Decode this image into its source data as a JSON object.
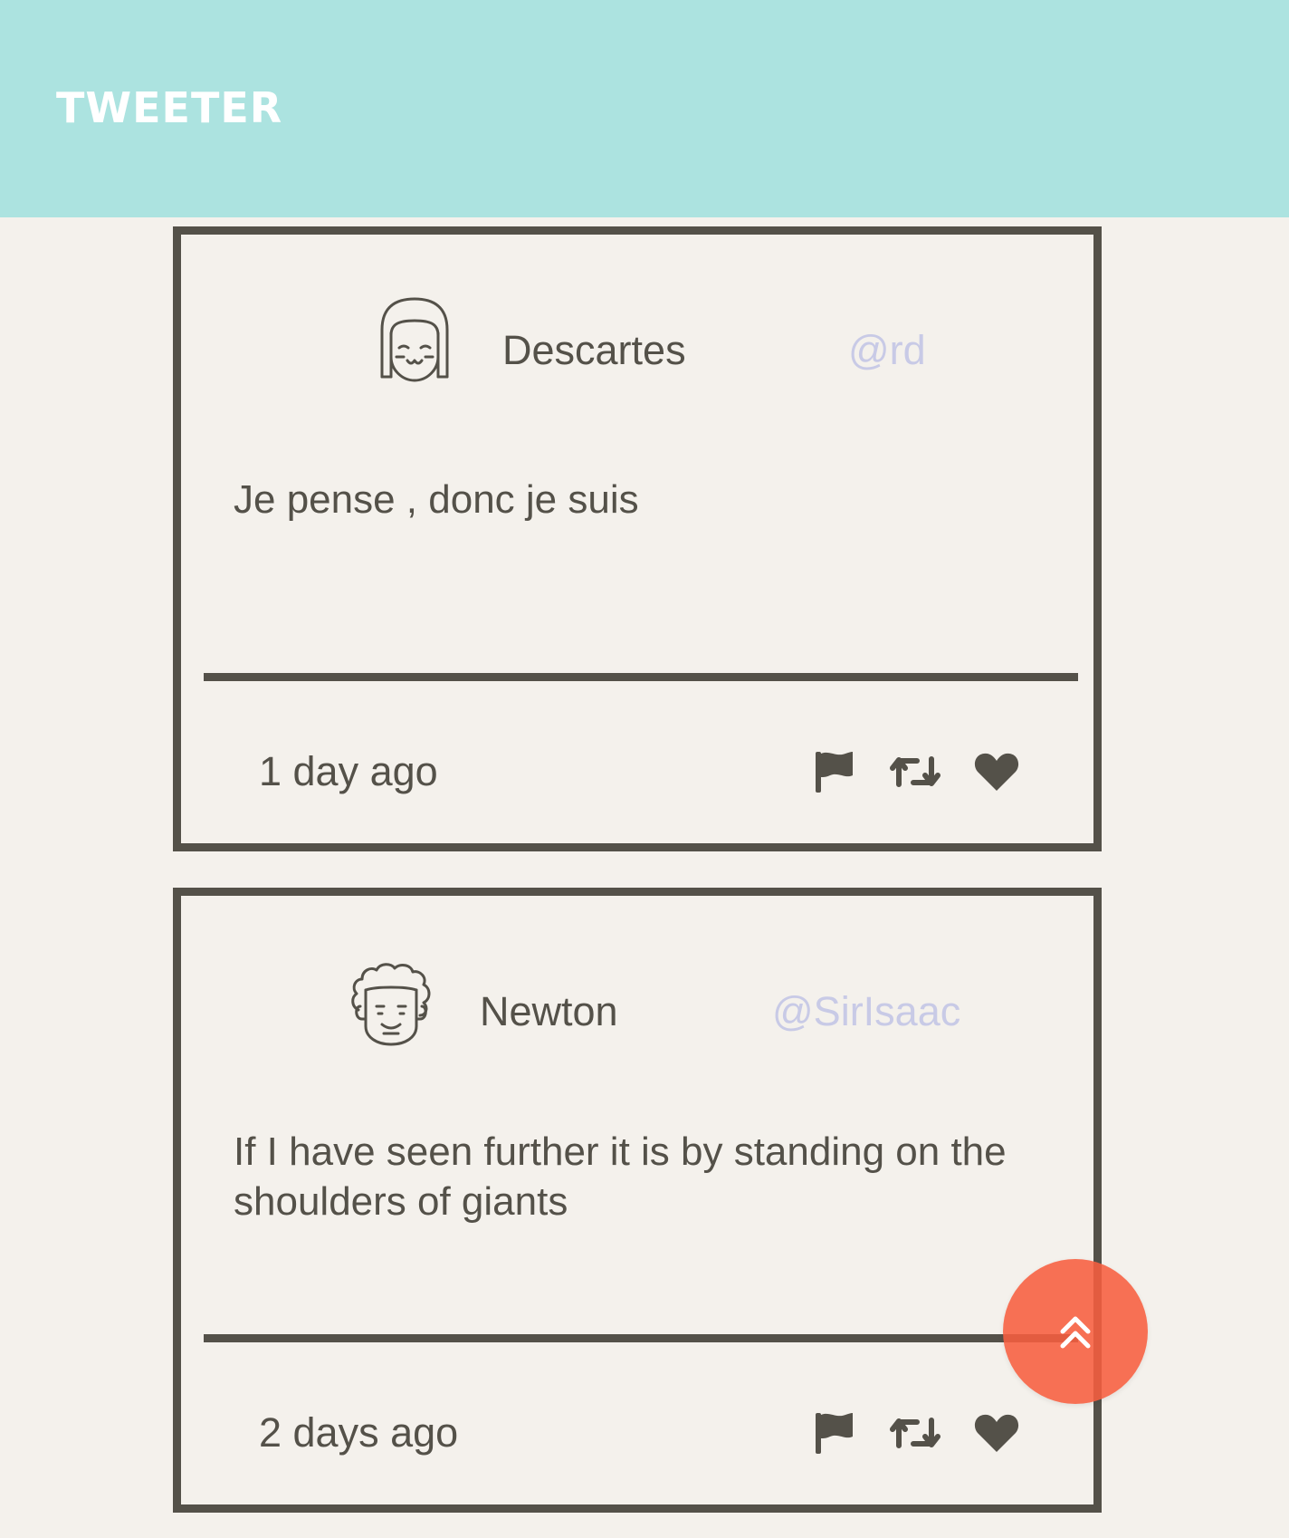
{
  "header": {
    "brand": "TWEETER",
    "background_color": "#ace3e0"
  },
  "tweets": [
    {
      "author_name": "Descartes",
      "handle": "@rd",
      "avatar_icon": "girl-face-avatar-icon",
      "text": "Je pense , donc je suis",
      "timestamp": "1 day ago",
      "actions": [
        "flag-icon",
        "retweet-icon",
        "heart-icon"
      ]
    },
    {
      "author_name": "Newton",
      "handle": "@SirIsaac",
      "avatar_icon": "curly-hair-face-avatar-icon",
      "text": "If I have seen further it is by standing on the shoulders of giants",
      "timestamp": "2 days ago",
      "actions": [
        "flag-icon",
        "retweet-icon",
        "heart-icon"
      ]
    }
  ],
  "scroll_to_top": {
    "icon": "double-chevron-up-icon",
    "color": "#f75d3f"
  },
  "colors": {
    "ink": "#545149",
    "handle": "#c8cae6",
    "page_background": "#f4f1ec"
  }
}
